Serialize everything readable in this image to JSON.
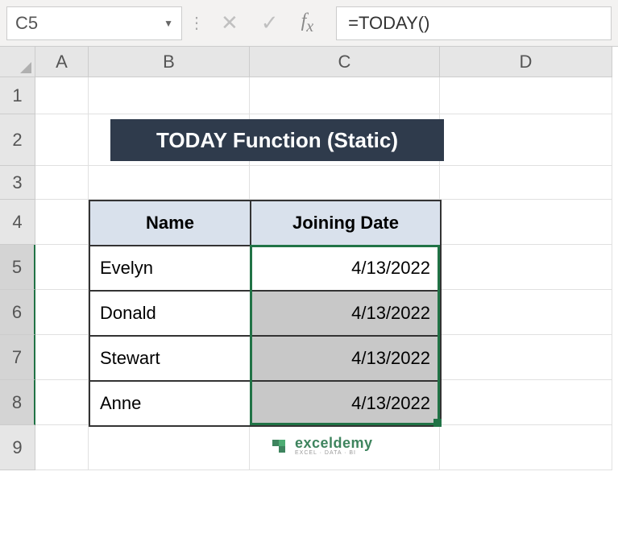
{
  "nameBox": "C5",
  "formula": "=TODAY()",
  "columns": [
    "A",
    "B",
    "C",
    "D"
  ],
  "rows": [
    "1",
    "2",
    "3",
    "4",
    "5",
    "6",
    "7",
    "8",
    "9"
  ],
  "title": "TODAY Function (Static)",
  "table": {
    "headers": {
      "name": "Name",
      "date": "Joining Date"
    },
    "rows": [
      {
        "name": "Evelyn",
        "date": "4/13/2022"
      },
      {
        "name": "Donald",
        "date": "4/13/2022"
      },
      {
        "name": "Stewart",
        "date": "4/13/2022"
      },
      {
        "name": "Anne",
        "date": "4/13/2022"
      }
    ]
  },
  "watermark": {
    "main": "exceldemy",
    "sub": "EXCEL · DATA · BI"
  },
  "chart_data": {
    "type": "table",
    "title": "TODAY Function (Static)",
    "columns": [
      "Name",
      "Joining Date"
    ],
    "rows": [
      [
        "Evelyn",
        "4/13/2022"
      ],
      [
        "Donald",
        "4/13/2022"
      ],
      [
        "Stewart",
        "4/13/2022"
      ],
      [
        "Anne",
        "4/13/2022"
      ]
    ]
  }
}
